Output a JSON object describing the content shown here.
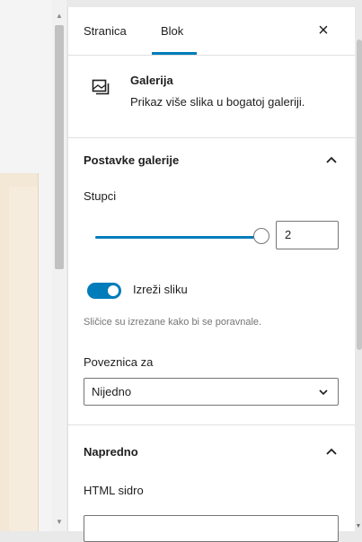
{
  "tabs": {
    "page": "Stranica",
    "block": "Blok"
  },
  "close_icon": "×",
  "block": {
    "icon": "gallery-icon",
    "title": "Galerija",
    "description": "Prikaz više slika u bogatoj galeriji."
  },
  "gallery_settings": {
    "title": "Postavke galerije",
    "columns_label": "Stupci",
    "columns_value": "2",
    "crop_label": "Izreži sliku",
    "crop_enabled": true,
    "crop_help": "Sličice su izrezane kako bi se poravnale.",
    "link_label": "Poveznica za",
    "link_value": "Nijedno"
  },
  "advanced": {
    "title": "Napredno",
    "anchor_label": "HTML sidro",
    "anchor_value": ""
  },
  "colors": {
    "accent": "#007cba",
    "border": "#757575",
    "divider": "#e0e0e0"
  }
}
